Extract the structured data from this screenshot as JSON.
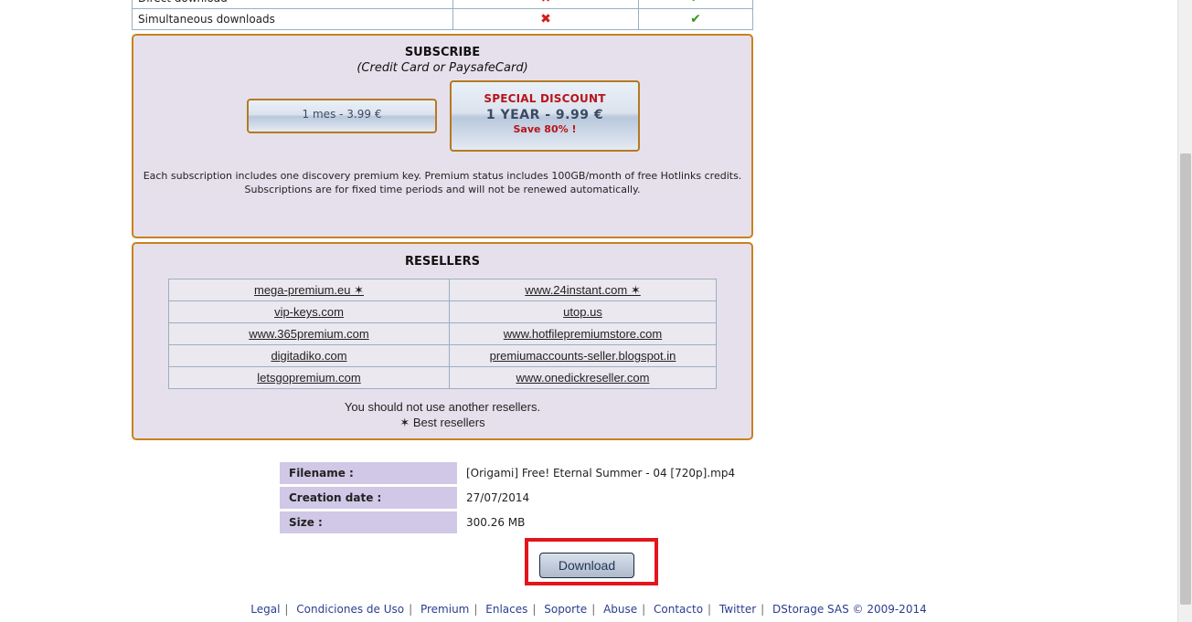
{
  "compare": {
    "rows": [
      {
        "label": "Direct download",
        "free_icon": "x-mark-icon",
        "premium_icon": "check-icon"
      },
      {
        "label": "Simultaneous downloads",
        "free_icon": "x-mark-icon",
        "premium_icon": "check-icon"
      }
    ]
  },
  "subscribe": {
    "title": "SUBSCRIBE",
    "subtitle": "(Credit Card or PaysafeCard)",
    "plan_month": "1 mes - 3.99 €",
    "plan_year_label": "SPECIAL DISCOUNT",
    "plan_year_price": "1 YEAR - 9.99 €",
    "plan_year_save": "Save 80% !",
    "note_line1": "Each subscription includes one discovery premium key. Premium status includes 100GB/month of free Hotlinks credits.",
    "note_line2": "Subscriptions are for fixed time periods and will not be renewed automatically."
  },
  "resellers": {
    "title": "RESELLERS",
    "rows": [
      [
        "mega-premium.eu ✶",
        "www.24instant.com ✶"
      ],
      [
        "vip-keys.com",
        "utop.us"
      ],
      [
        "www.365premium.com",
        "www.hotfilepremiumstore.com"
      ],
      [
        "digitadiko.com",
        "premiumaccounts-seller.blogspot.in"
      ],
      [
        "letsgopremium.com",
        "www.onedickreseller.com"
      ]
    ],
    "note_line1": "You should not use another resellers.",
    "note_line2": "✶ Best resellers"
  },
  "file": {
    "filename_label": "Filename :",
    "filename": "[Origami] Free! Eternal Summer - 04 [720p].mp4",
    "date_label": "Creation date :",
    "date": "27/07/2014",
    "size_label": "Size :",
    "size": "300.26 MB"
  },
  "download_label": "Download",
  "footer": {
    "links": [
      "Legal",
      "Condiciones de Uso",
      "Premium",
      "Enlaces",
      "Soporte",
      "Abuse",
      "Contacto",
      "Twitter"
    ],
    "copyright": "DStorage SAS © 2009-2014"
  },
  "colors": {
    "box_border": "#c8821e",
    "box_bg": "#e6e0ec",
    "discount_red": "#b8141a",
    "highlight_frame": "#e4141c",
    "link_blue": "#2a3d8f"
  }
}
